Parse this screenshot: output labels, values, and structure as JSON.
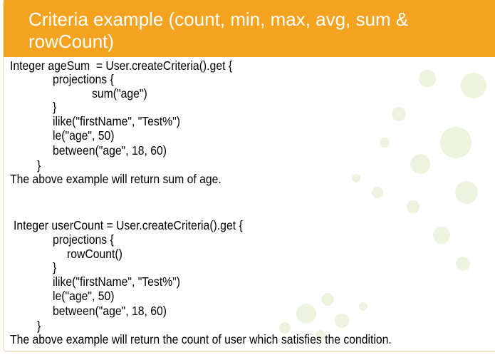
{
  "slide": {
    "title": "Criteria example (count, min, max, avg, sum & rowCount)",
    "accent_color": "#F4A321",
    "decoration_color": "#B5D334",
    "example1": {
      "code": [
        "Integer ageSum  = User.createCriteria().get {",
        "projections {",
        "sum(\"age\")",
        "}",
        "ilike(\"firstName\", \"Test%\")",
        "le(\"age\", 50)",
        "between(\"age\", 18, 60)",
        "}"
      ],
      "note": "The above example will return sum of age."
    },
    "example2": {
      "code": [
        "Integer userCount = User.createCriteria().get {",
        "projections {",
        "rowCount()",
        "}",
        "ilike(\"firstName\", \"Test%\")",
        "le(\"age\", 50)",
        "between(\"age\", 18, 60)",
        "}"
      ],
      "note": "The above example will return the count of user which satisfies the condition."
    }
  }
}
